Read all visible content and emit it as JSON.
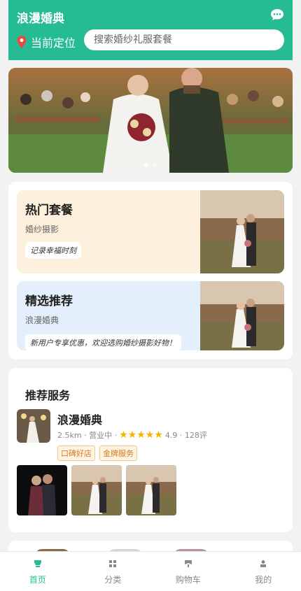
{
  "header": {
    "title": "浪漫婚典",
    "location_label": "当前定位",
    "search_placeholder": "搜索婚纱礼服套餐",
    "accent": "#25bc94"
  },
  "banner": {
    "dots": 2,
    "active_dot": 0
  },
  "promos": [
    {
      "title": "热门套餐",
      "subtitle": "婚纱摄影",
      "tag": "记录幸福时刻",
      "bg": "#fdf0dc"
    },
    {
      "title": "精选推荐",
      "subtitle": "浪漫婚典",
      "tag": "新用户专享优惠，欢迎选购婚纱摄影好物！",
      "bg": "#e3f0fc"
    }
  ],
  "recommend": {
    "section_title": "推荐服务",
    "shop": {
      "name": "浪漫婚典",
      "distance": "2.5km",
      "status": "营业中",
      "stars": "★★★★★",
      "rating": "4.9",
      "reviews": "128评",
      "badges": [
        "口碑好店",
        "金牌服务"
      ]
    }
  },
  "tabs": [
    {
      "label": "首页",
      "icon": "home-icon"
    },
    {
      "label": "分类",
      "icon": "grid-icon"
    },
    {
      "label": "购物车",
      "icon": "cart-icon"
    },
    {
      "label": "我的",
      "icon": "user-icon"
    }
  ]
}
